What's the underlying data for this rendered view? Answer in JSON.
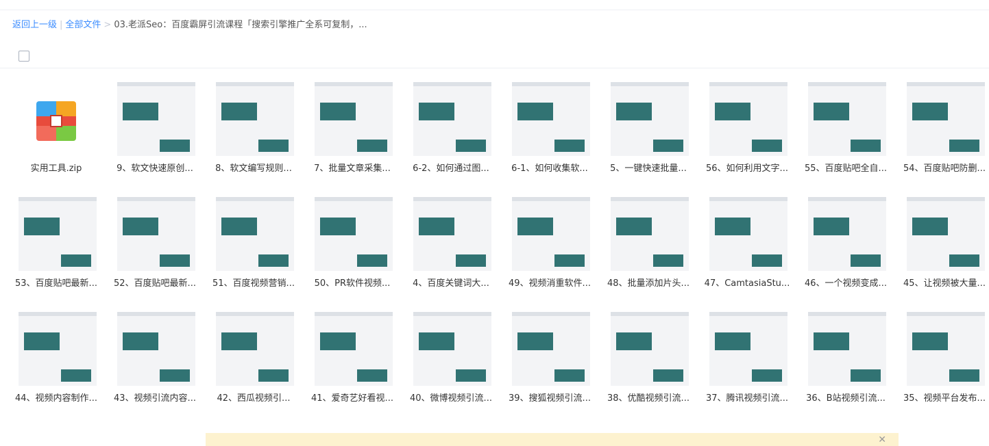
{
  "breadcrumb": {
    "back": "返回上一级",
    "all": "全部文件",
    "current": "03.老派Seo：百度霸屏引流课程「搜索引擎推广全系可复制，..."
  },
  "colors": {
    "link": "#3b8cff",
    "thumb_watermark": "#0e5c5c",
    "banner": "#fdf2cf"
  },
  "files": [
    {
      "name": "实用工具.zip",
      "icon": "zip-archive-icon"
    },
    {
      "name": "9、软文快速原创...",
      "icon": "video-thumbnail"
    },
    {
      "name": "8、软文编写规则...",
      "icon": "video-thumbnail"
    },
    {
      "name": "7、批量文章采集...",
      "icon": "video-thumbnail"
    },
    {
      "name": "6-2、如何通过图...",
      "icon": "video-thumbnail"
    },
    {
      "name": "6-1、如何收集软...",
      "icon": "video-thumbnail"
    },
    {
      "name": "5、一键快速批量...",
      "icon": "video-thumbnail"
    },
    {
      "name": "56、如何利用文字...",
      "icon": "video-thumbnail"
    },
    {
      "name": "55、百度贴吧全自...",
      "icon": "video-thumbnail"
    },
    {
      "name": "54、百度贴吧防删...",
      "icon": "video-thumbnail"
    },
    {
      "name": "53、百度贴吧最新...",
      "icon": "video-thumbnail"
    },
    {
      "name": "52、百度贴吧最新...",
      "icon": "video-thumbnail"
    },
    {
      "name": "51、百度视频营销...",
      "icon": "video-thumbnail"
    },
    {
      "name": "50、PR软件视频...",
      "icon": "video-thumbnail"
    },
    {
      "name": "4、百度关键词大...",
      "icon": "video-thumbnail"
    },
    {
      "name": "49、视频消重软件...",
      "icon": "video-thumbnail"
    },
    {
      "name": "48、批量添加片头...",
      "icon": "video-thumbnail"
    },
    {
      "name": "47、CamtasiaStu...",
      "icon": "video-thumbnail"
    },
    {
      "name": "46、一个视频变成...",
      "icon": "video-thumbnail"
    },
    {
      "name": "45、让视频被大量...",
      "icon": "video-thumbnail"
    },
    {
      "name": "44、视频内容制作...",
      "icon": "video-thumbnail"
    },
    {
      "name": "43、视频引流内容...",
      "icon": "video-thumbnail"
    },
    {
      "name": "42、西瓜视频引...",
      "icon": "video-thumbnail"
    },
    {
      "name": "41、爱奇艺好看视...",
      "icon": "video-thumbnail"
    },
    {
      "name": "40、微博视频引流...",
      "icon": "video-thumbnail"
    },
    {
      "name": "39、搜狐视频引流...",
      "icon": "video-thumbnail"
    },
    {
      "name": "38、优酷视频引流...",
      "icon": "video-thumbnail"
    },
    {
      "name": "37、腾讯视频引流...",
      "icon": "video-thumbnail"
    },
    {
      "name": "36、B站视频引流...",
      "icon": "video-thumbnail"
    },
    {
      "name": "35、视频平台发布...",
      "icon": "video-thumbnail"
    }
  ]
}
